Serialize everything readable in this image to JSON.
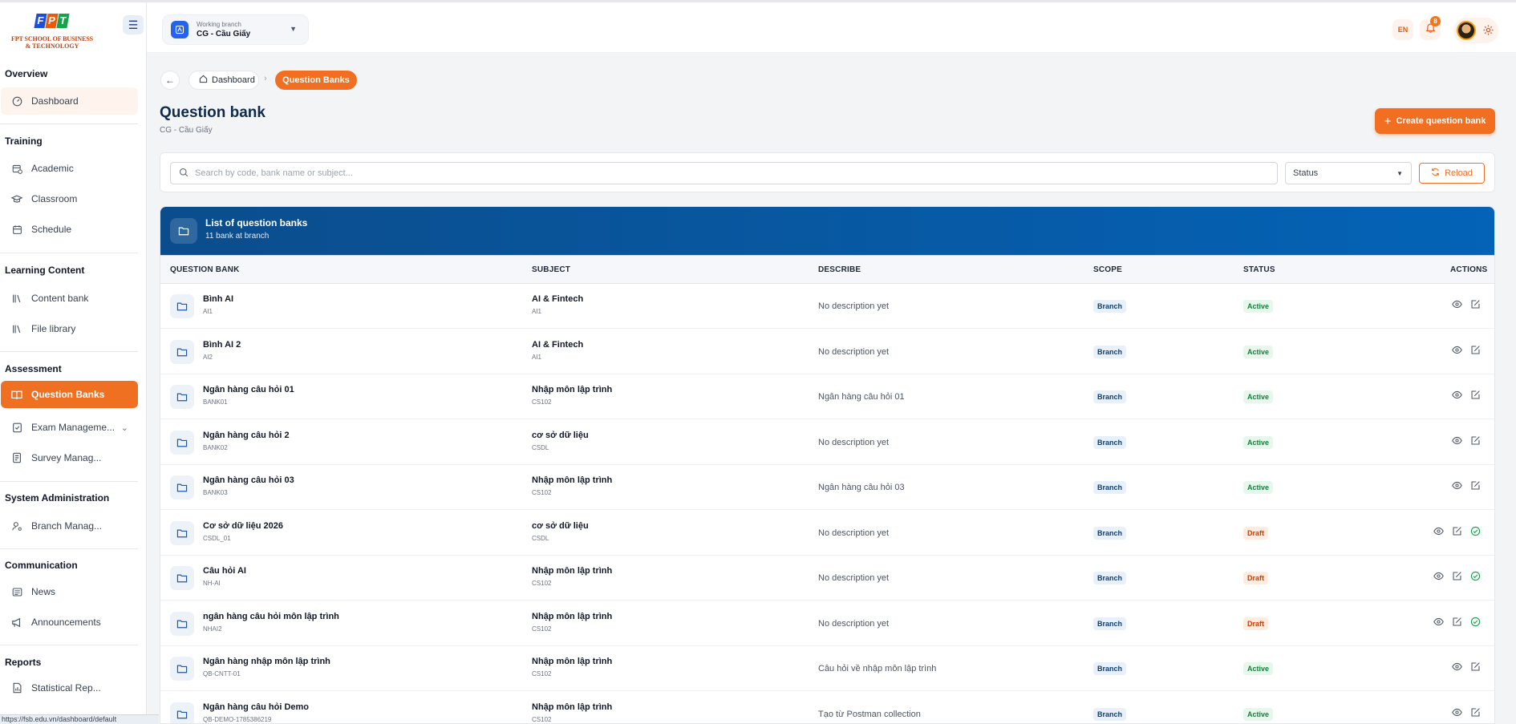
{
  "brand": {
    "logo_letters": [
      "F",
      "P",
      "T"
    ],
    "line1": "FPT SCHOOL OF BUSINESS",
    "line2": "& TECHNOLOGY",
    "colors": [
      "#1d4ed8",
      "#ea580c",
      "#16a34a"
    ]
  },
  "sidebar": {
    "sections": [
      {
        "title": "Overview",
        "items": [
          {
            "label": "Dashboard",
            "icon": "gauge-icon"
          }
        ]
      },
      {
        "title": "Training",
        "items": [
          {
            "label": "Academic",
            "icon": "calendar-clock-icon"
          },
          {
            "label": "Classroom",
            "icon": "graduation-cap-icon"
          },
          {
            "label": "Schedule",
            "icon": "calendar-icon"
          }
        ]
      },
      {
        "title": "Learning Content",
        "items": [
          {
            "label": "Content bank",
            "icon": "library-icon"
          },
          {
            "label": "File library",
            "icon": "library-icon"
          }
        ]
      },
      {
        "title": "Assessment",
        "items": [
          {
            "label": "Question Banks",
            "icon": "book-open-icon"
          },
          {
            "label": "Exam Manageme...",
            "icon": "clipboard-check-icon"
          },
          {
            "label": "Survey Manag...",
            "icon": "survey-icon"
          }
        ]
      },
      {
        "title": "System Administration",
        "items": [
          {
            "label": "Branch Manag...",
            "icon": "user-cog-icon"
          }
        ]
      },
      {
        "title": "Communication",
        "items": [
          {
            "label": "News",
            "icon": "newspaper-icon"
          },
          {
            "label": "Announcements",
            "icon": "megaphone-icon"
          }
        ]
      },
      {
        "title": "Reports",
        "items": [
          {
            "label": "Statistical Rep...",
            "icon": "report-icon"
          }
        ]
      }
    ],
    "status_url": "https://fsb.edu.vn/dashboard/default"
  },
  "header": {
    "branch_label": "Working branch",
    "branch_value": "CG - Cầu Giấy",
    "lang": "EN",
    "notif_count": "8"
  },
  "breadcrumb": {
    "home": "Dashboard",
    "current": "Question Banks"
  },
  "page": {
    "title": "Question bank",
    "subtitle": "CG - Cầu Giấy",
    "create_label": "Create question bank"
  },
  "filters": {
    "search_placeholder": "Search by code, bank name or subject...",
    "status_label": "Status",
    "reload_label": "Reload"
  },
  "table": {
    "title": "List of question banks",
    "subtitle": "11 bank at branch",
    "columns": [
      "QUESTION BANK",
      "SUBJECT",
      "DESCRIBE",
      "SCOPE",
      "STATUS",
      "ACTIONS"
    ],
    "rows": [
      {
        "name": "Bình AI",
        "code": "AI1",
        "subject": "AI & Fintech",
        "subject_code": "AI1",
        "describe": "No description yet",
        "scope": "Branch",
        "status": "Active"
      },
      {
        "name": "Bình AI 2",
        "code": "AI2",
        "subject": "AI & Fintech",
        "subject_code": "AI1",
        "describe": "No description yet",
        "scope": "Branch",
        "status": "Active"
      },
      {
        "name": "Ngân hàng câu hỏi 01",
        "code": "BANK01",
        "subject": "Nhập môn lập trình",
        "subject_code": "CS102",
        "describe": "Ngân hàng câu hỏi 01",
        "scope": "Branch",
        "status": "Active"
      },
      {
        "name": "Ngân hàng câu hỏi 2",
        "code": "BANK02",
        "subject": "cơ sở dữ liệu",
        "subject_code": "CSDL",
        "describe": "No description yet",
        "scope": "Branch",
        "status": "Active"
      },
      {
        "name": "Ngân hàng câu hỏi 03",
        "code": "BANK03",
        "subject": "Nhập môn lập trình",
        "subject_code": "CS102",
        "describe": "Ngân hàng câu hỏi 03",
        "scope": "Branch",
        "status": "Active"
      },
      {
        "name": "Cơ sở dữ liệu 2026",
        "code": "CSDL_01",
        "subject": "cơ sở dữ liệu",
        "subject_code": "CSDL",
        "describe": "No description yet",
        "scope": "Branch",
        "status": "Draft"
      },
      {
        "name": "Câu hỏi AI",
        "code": "NH-AI",
        "subject": "Nhập môn lập trình",
        "subject_code": "CS102",
        "describe": "No description yet",
        "scope": "Branch",
        "status": "Draft"
      },
      {
        "name": "ngân hàng câu hỏi môn lập trình",
        "code": "NHAI2",
        "subject": "Nhập môn lập trình",
        "subject_code": "CS102",
        "describe": "No description yet",
        "scope": "Branch",
        "status": "Draft"
      },
      {
        "name": "Ngân hàng nhập môn lập trình",
        "code": "QB-CNTT-01",
        "subject": "Nhập môn lập trình",
        "subject_code": "CS102",
        "describe": "Câu hỏi về nhập môn lập trình",
        "scope": "Branch",
        "status": "Active"
      },
      {
        "name": "Ngân hàng câu hỏi Demo",
        "code": "QB-DEMO-1785386219",
        "subject": "Nhập môn lập trình",
        "subject_code": "CS102",
        "describe": "Tạo từ Postman collection",
        "scope": "Branch",
        "status": "Active"
      }
    ]
  },
  "theme": {
    "accent": "#f26f21",
    "primary": "#0b4d8c",
    "active": "#15803d",
    "draft": "#c2410c"
  }
}
